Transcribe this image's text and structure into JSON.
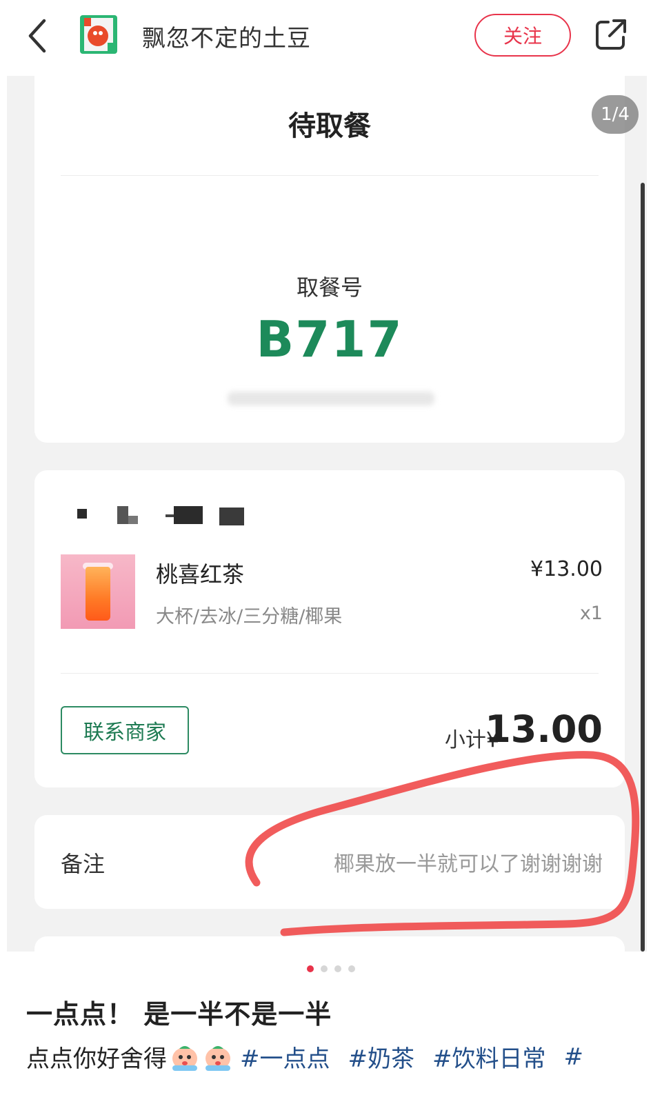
{
  "header": {
    "author_name": "飘忽不定的土豆",
    "follow_label": "关注"
  },
  "image_counter": "1/4",
  "order": {
    "status_title": "待取餐",
    "pickup_label": "取餐号",
    "pickup_number": "B717",
    "item": {
      "name": "桃喜红茶",
      "spec": "大杯/去冰/三分糖/椰果",
      "price": "¥13.00",
      "qty": "x1"
    },
    "contact_label": "联系商家",
    "subtotal_label": "小计¥",
    "subtotal_value": "13.00",
    "remark_label": "备注",
    "remark_value": "椰果放一半就可以了谢谢谢谢"
  },
  "carousel": {
    "total": 4,
    "active": 0
  },
  "post": {
    "title": "一点点！ 是一半不是一半",
    "body_text": "点点你好舍得",
    "tags": [
      "#一点点",
      "#奶茶",
      "#饮料日常",
      "#"
    ]
  },
  "colors": {
    "brand_red": "#e8334a",
    "pickup_green": "#1d8a5a",
    "tag_blue": "#234f8a",
    "annotation_red": "#ef4a4a"
  }
}
